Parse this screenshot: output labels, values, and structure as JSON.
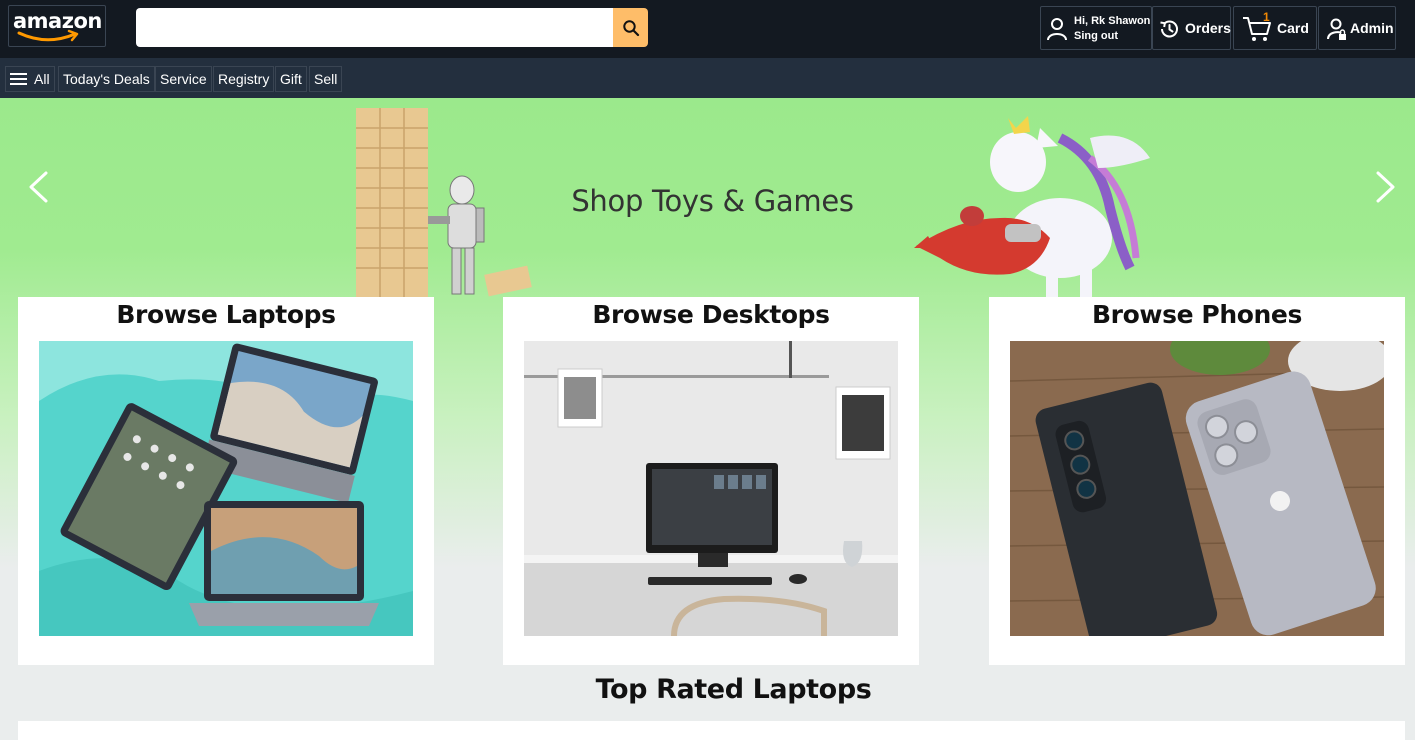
{
  "header": {
    "logo_text": "amazon",
    "search": {
      "value": "",
      "placeholder": ""
    },
    "account": {
      "greeting": "Hi, Rk Shawon",
      "signout": "Sing out"
    },
    "orders_label": "Orders",
    "cart": {
      "count": "1",
      "label": "Card"
    },
    "admin_label": "Admin",
    "colors": {
      "bg": "#131921",
      "search_button": "#febd69",
      "cart_count": "#f08804"
    }
  },
  "subnav": {
    "items": [
      {
        "label": "All",
        "icon": "hamburger-icon"
      },
      {
        "label": "Today's Deals"
      },
      {
        "label": "Service"
      },
      {
        "label": "Registry"
      },
      {
        "label": "Gift"
      },
      {
        "label": "Sell"
      }
    ]
  },
  "hero": {
    "title": "Shop Toys & Games",
    "prev_icon": "chevron-left-icon",
    "next_icon": "chevron-right-icon"
  },
  "cards": [
    {
      "title": "Browse Laptops"
    },
    {
      "title": "Browse Desktops"
    },
    {
      "title": "Browse Phones"
    }
  ],
  "sections": {
    "top_rated_title": "Top Rated Laptops"
  }
}
